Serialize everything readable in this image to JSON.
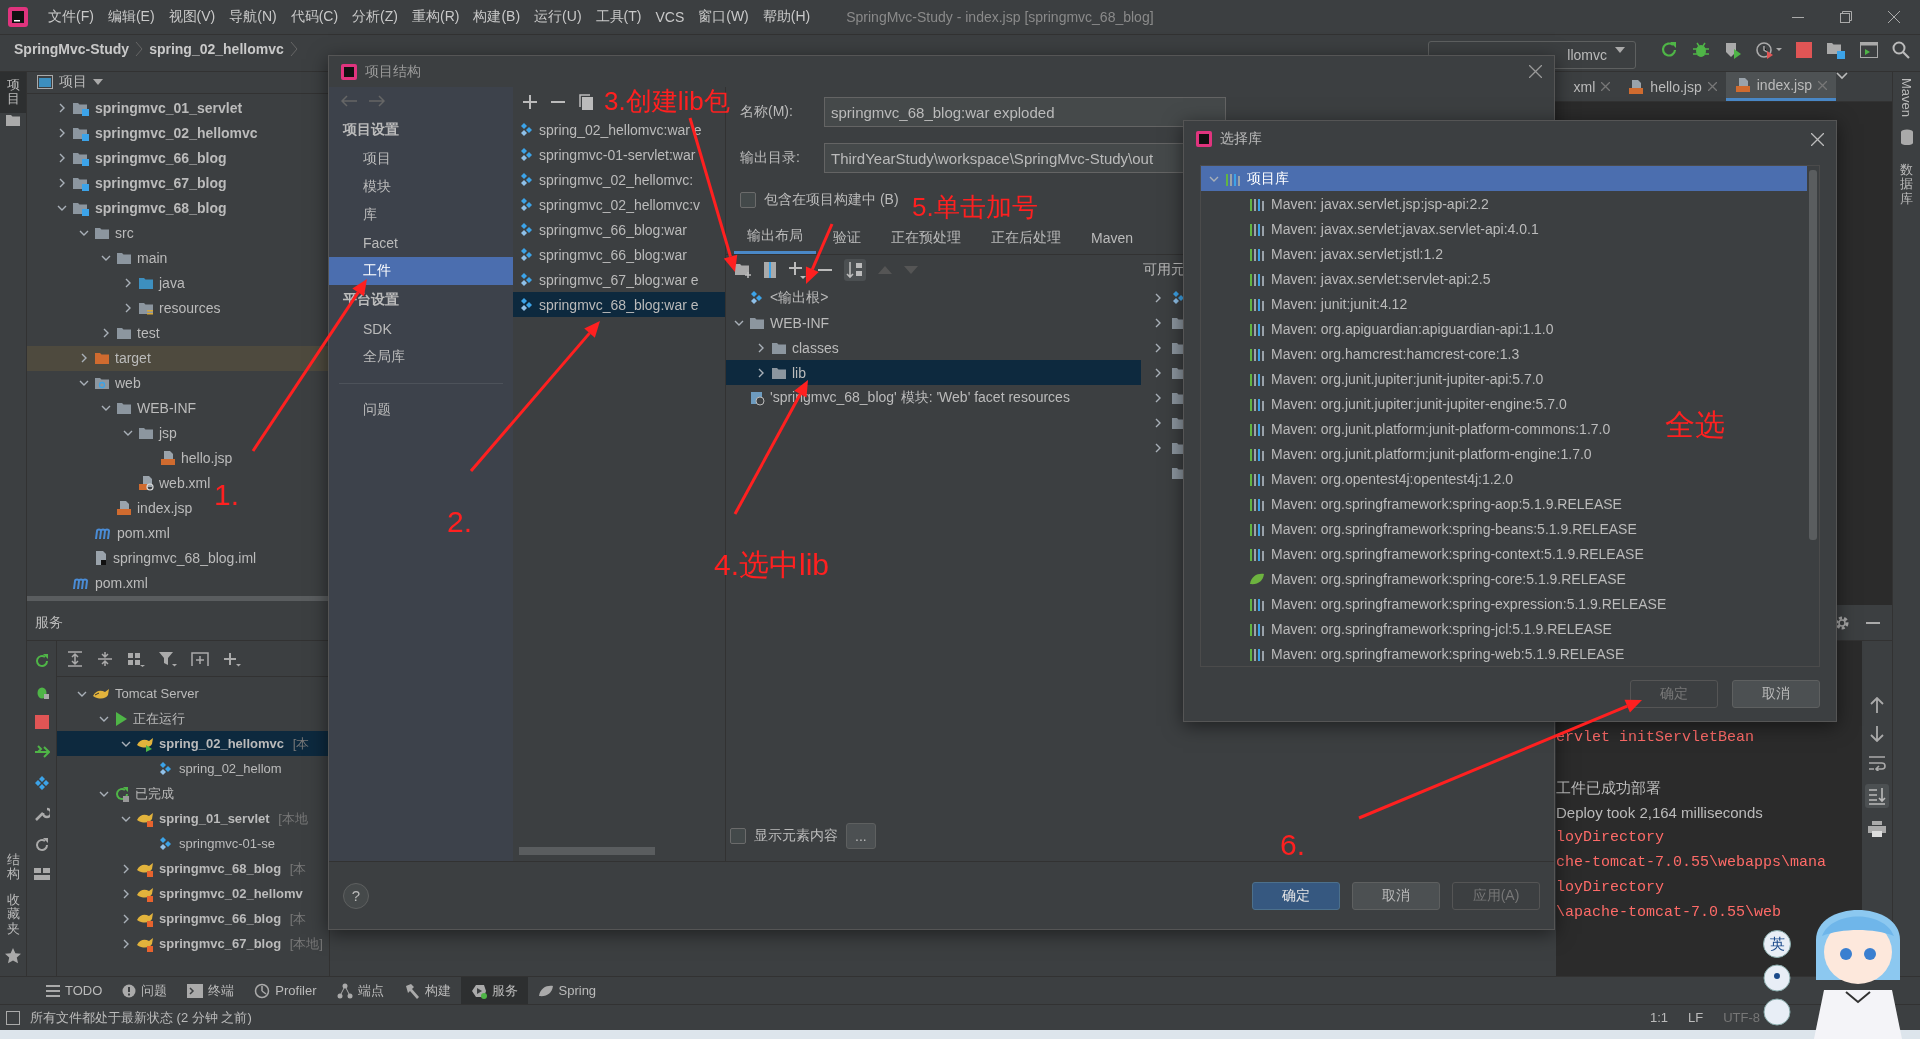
{
  "title_bar": {
    "menus": [
      "文件(F)",
      "编辑(E)",
      "视图(V)",
      "导航(N)",
      "代码(C)",
      "分析(Z)",
      "重构(R)",
      "构建(B)",
      "运行(U)",
      "工具(T)",
      "VCS",
      "窗口(W)",
      "帮助(H)"
    ],
    "title": "SpringMvc-Study - index.jsp [springmvc_68_blog]"
  },
  "breadcrumb": [
    "SpringMvc-Study",
    "spring_02_hellomvc"
  ],
  "run_config": "llomvc",
  "editor_tabs": [
    {
      "label": "xml",
      "selected": false
    },
    {
      "label": "hello.jsp",
      "selected": false
    },
    {
      "label": "index.jsp",
      "selected": true
    }
  ],
  "left_strip": {
    "top": {
      "label": "项目",
      "selected": true
    },
    "bottom": [
      {
        "label": "结构",
        "selected": false
      },
      {
        "label": "收藏夹",
        "selected": false
      }
    ]
  },
  "right_strip": [
    {
      "label": "Maven",
      "selected": false
    },
    {
      "label": "数据库",
      "selected": false
    }
  ],
  "project_panel": {
    "title": "项目",
    "tree": [
      {
        "label": "springmvc_01_servlet",
        "kind": "module",
        "expanded": false,
        "selected": false
      },
      {
        "label": "springmvc_02_hellomvc",
        "kind": "module",
        "expanded": false,
        "selected": false
      },
      {
        "label": "springmvc_66_blog",
        "kind": "module",
        "expanded": false,
        "selected": false
      },
      {
        "label": "springmvc_67_blog",
        "kind": "module",
        "expanded": false,
        "selected": false
      },
      {
        "label": "springmvc_68_blog",
        "kind": "module",
        "expanded": true,
        "selected": false,
        "children": [
          {
            "label": "src",
            "kind": "folder",
            "expanded": true,
            "selected": false,
            "children": [
              {
                "label": "main",
                "kind": "folder",
                "expanded": true,
                "selected": false,
                "children": [
                  {
                    "label": "java",
                    "kind": "source",
                    "expanded": false,
                    "selected": false
                  },
                  {
                    "label": "resources",
                    "kind": "resources",
                    "expanded": false,
                    "selected": false
                  }
                ]
              },
              {
                "label": "test",
                "kind": "folder",
                "expanded": false,
                "selected": false
              }
            ]
          },
          {
            "label": "target",
            "kind": "excluded",
            "expanded": false,
            "selected": true
          },
          {
            "label": "web",
            "kind": "web",
            "expanded": true,
            "selected": false,
            "children": [
              {
                "label": "WEB-INF",
                "kind": "folder",
                "expanded": true,
                "selected": false,
                "children": [
                  {
                    "label": "jsp",
                    "kind": "folder",
                    "expanded": true,
                    "selected": false,
                    "children": [
                      {
                        "label": "hello.jsp",
                        "kind": "jsp",
                        "selected": false
                      }
                    ]
                  },
                  {
                    "label": "web.xml",
                    "kind": "xml",
                    "selected": false
                  }
                ]
              },
              {
                "label": "index.jsp",
                "kind": "jsp",
                "selected": false
              }
            ]
          },
          {
            "label": "pom.xml",
            "kind": "maven",
            "selected": false
          },
          {
            "label": "springmvc_68_blog.iml",
            "kind": "iml",
            "selected": false
          }
        ]
      },
      {
        "label": "pom.xml",
        "kind": "maven",
        "selected": false
      }
    ]
  },
  "services_panel": {
    "title": "服务",
    "tree": [
      {
        "label": "Tomcat Server",
        "kind": "server",
        "expanded": true,
        "selected": false,
        "children": [
          {
            "label": "正在运行",
            "kind": "running",
            "expanded": true,
            "selected": false,
            "children": [
              {
                "label": "spring_02_hellomvc",
                "suffix": "[本",
                "kind": "deploy-running",
                "expanded": true,
                "selected": true,
                "children": [
                  {
                    "label": "spring_02_hellom",
                    "kind": "artifact",
                    "selected": false
                  }
                ]
              }
            ]
          },
          {
            "label": "已完成",
            "kind": "finished",
            "expanded": true,
            "selected": false,
            "children": [
              {
                "label": "spring_01_servlet",
                "suffix": "[本地",
                "kind": "deploy",
                "expanded": true,
                "selected": false,
                "children": [
                  {
                    "label": "springmvc-01-se",
                    "kind": "artifact",
                    "selected": false
                  }
                ]
              },
              {
                "label": "springmvc_68_blog",
                "suffix": "[本",
                "kind": "deploy",
                "expanded": false,
                "selected": false
              },
              {
                "label": "springmvc_02_hellomv",
                "kind": "deploy",
                "expanded": false,
                "selected": false
              },
              {
                "label": "springmvc_66_blog",
                "suffix": "[本",
                "kind": "deploy",
                "expanded": false,
                "selected": false
              },
              {
                "label": "springmvc_67_blog",
                "suffix": "[本地]",
                "kind": "deploy",
                "expanded": false,
                "selected": false
              }
            ]
          }
        ]
      }
    ]
  },
  "console": [
    {
      "text": "ervlet initServletBean",
      "kind": "error"
    },
    {
      "text": "工件已成功部署",
      "kind": "info"
    },
    {
      "text": "Deploy took 2,164 milliseconds",
      "kind": "info"
    },
    {
      "text": "loyDirectory",
      "kind": "error"
    },
    {
      "text": "che-tomcat-7.0.55\\webapps\\mana",
      "kind": "error"
    },
    {
      "text": "loyDirectory",
      "kind": "error"
    },
    {
      "text": "\\apache-tomcat-7.0.55\\web",
      "kind": "error"
    }
  ],
  "tool_tabs": [
    {
      "label": "TODO",
      "selected": false
    },
    {
      "label": "问题",
      "selected": false
    },
    {
      "label": "终端",
      "selected": false
    },
    {
      "label": "Profiler",
      "selected": false
    },
    {
      "label": "端点",
      "selected": false
    },
    {
      "label": "构建",
      "selected": false
    },
    {
      "label": "服务",
      "selected": true
    },
    {
      "label": "Spring",
      "selected": false
    }
  ],
  "status_bar": {
    "message": "所有文件都处于最新状态 (2 分钟 之前)",
    "position": "1:1",
    "line_ending": "LF",
    "encoding": "UTF-8"
  },
  "project_structure": {
    "title": "项目结构",
    "nav": [
      {
        "heading": "项目设置",
        "items": [
          {
            "label": "项目",
            "selected": false
          },
          {
            "label": "模块",
            "selected": false
          },
          {
            "label": "库",
            "selected": false
          },
          {
            "label": "Facet",
            "selected": false
          },
          {
            "label": "工件",
            "selected": true
          }
        ]
      },
      {
        "heading": "平台设置",
        "items": [
          {
            "label": "SDK",
            "selected": false
          },
          {
            "label": "全局库",
            "selected": false
          }
        ]
      }
    ],
    "problems": "问题",
    "artifacts": [
      {
        "label": "spring_02_hellomvc:war e",
        "selected": false
      },
      {
        "label": "springmvc-01-servlet:war",
        "selected": false
      },
      {
        "label": "springmvc_02_hellomvc:",
        "selected": false
      },
      {
        "label": "springmvc_02_hellomvc:v",
        "selected": false
      },
      {
        "label": "springmvc_66_blog:war",
        "selected": false
      },
      {
        "label": "springmvc_66_blog:war",
        "selected": false
      },
      {
        "label": "springmvc_67_blog:war e",
        "selected": false
      },
      {
        "label": "springmvc_68_blog:war e",
        "selected": true
      }
    ],
    "name_label": "名称(M):",
    "name_value": "springmvc_68_blog:war exploded",
    "output_label": "输出目录:",
    "output_value": "ThirdYearStudy\\workspace\\SpringMvc-Study\\out",
    "include_in_build": {
      "label": "包含在项目构建中 (B)",
      "checked": false
    },
    "tabs": [
      {
        "label": "输出布局",
        "selected": true
      },
      {
        "label": "验证",
        "selected": false
      },
      {
        "label": "正在预处理",
        "selected": false
      },
      {
        "label": "正在后处理",
        "selected": false
      },
      {
        "label": "Maven",
        "selected": false
      }
    ],
    "available_label": "可用元",
    "layout_tree": [
      {
        "label": "<输出根>",
        "kind": "root",
        "selected": false
      },
      {
        "label": "WEB-INF",
        "kind": "folder",
        "expanded": true,
        "selected": false,
        "children": [
          {
            "label": "classes",
            "kind": "folder",
            "expanded": false,
            "selected": false
          },
          {
            "label": "lib",
            "kind": "folder",
            "expanded": false,
            "selected": true
          }
        ]
      },
      {
        "label": "'springmvc_68_blog' 模块: 'Web' facet resources",
        "kind": "facet",
        "selected": false
      }
    ],
    "show_contents": {
      "label": "显示元素内容",
      "checked": false
    },
    "more_button": "...",
    "help": "?",
    "buttons": [
      {
        "label": "确定",
        "kind": "primary"
      },
      {
        "label": "取消",
        "kind": "normal"
      },
      {
        "label": "应用(A)",
        "kind": "disabled"
      }
    ]
  },
  "choose_library": {
    "title": "选择库",
    "root": {
      "label": "项目库",
      "expanded": true,
      "selected": true
    },
    "libraries": [
      {
        "label": "Maven: javax.servlet.jsp:jsp-api:2.2",
        "kind": "maven"
      },
      {
        "label": "Maven: javax.servlet:javax.servlet-api:4.0.1",
        "kind": "maven"
      },
      {
        "label": "Maven: javax.servlet:jstl:1.2",
        "kind": "maven"
      },
      {
        "label": "Maven: javax.servlet:servlet-api:2.5",
        "kind": "maven"
      },
      {
        "label": "Maven: junit:junit:4.12",
        "kind": "maven"
      },
      {
        "label": "Maven: org.apiguardian:apiguardian-api:1.1.0",
        "kind": "maven"
      },
      {
        "label": "Maven: org.hamcrest:hamcrest-core:1.3",
        "kind": "maven"
      },
      {
        "label": "Maven: org.junit.jupiter:junit-jupiter-api:5.7.0",
        "kind": "maven"
      },
      {
        "label": "Maven: org.junit.jupiter:junit-jupiter-engine:5.7.0",
        "kind": "maven"
      },
      {
        "label": "Maven: org.junit.platform:junit-platform-commons:1.7.0",
        "kind": "maven"
      },
      {
        "label": "Maven: org.junit.platform:junit-platform-engine:1.7.0",
        "kind": "maven"
      },
      {
        "label": "Maven: org.opentest4j:opentest4j:1.2.0",
        "kind": "maven"
      },
      {
        "label": "Maven: org.springframework:spring-aop:5.1.9.RELEASE",
        "kind": "maven"
      },
      {
        "label": "Maven: org.springframework:spring-beans:5.1.9.RELEASE",
        "kind": "maven"
      },
      {
        "label": "Maven: org.springframework:spring-context:5.1.9.RELEASE",
        "kind": "maven"
      },
      {
        "label": "Maven: org.springframework:spring-core:5.1.9.RELEASE",
        "kind": "spring"
      },
      {
        "label": "Maven: org.springframework:spring-expression:5.1.9.RELEASE",
        "kind": "maven"
      },
      {
        "label": "Maven: org.springframework:spring-jcl:5.1.9.RELEASE",
        "kind": "maven"
      },
      {
        "label": "Maven: org.springframework:spring-web:5.1.9.RELEASE",
        "kind": "maven"
      }
    ],
    "buttons": [
      {
        "label": "确定",
        "kind": "disabled"
      },
      {
        "label": "取消",
        "kind": "normal"
      }
    ]
  },
  "annotations": [
    "1.",
    "2.",
    "3.创建lib包",
    "4.选中lib",
    "5.单击加号",
    "6.",
    "全选"
  ],
  "ime_indicator": "英"
}
